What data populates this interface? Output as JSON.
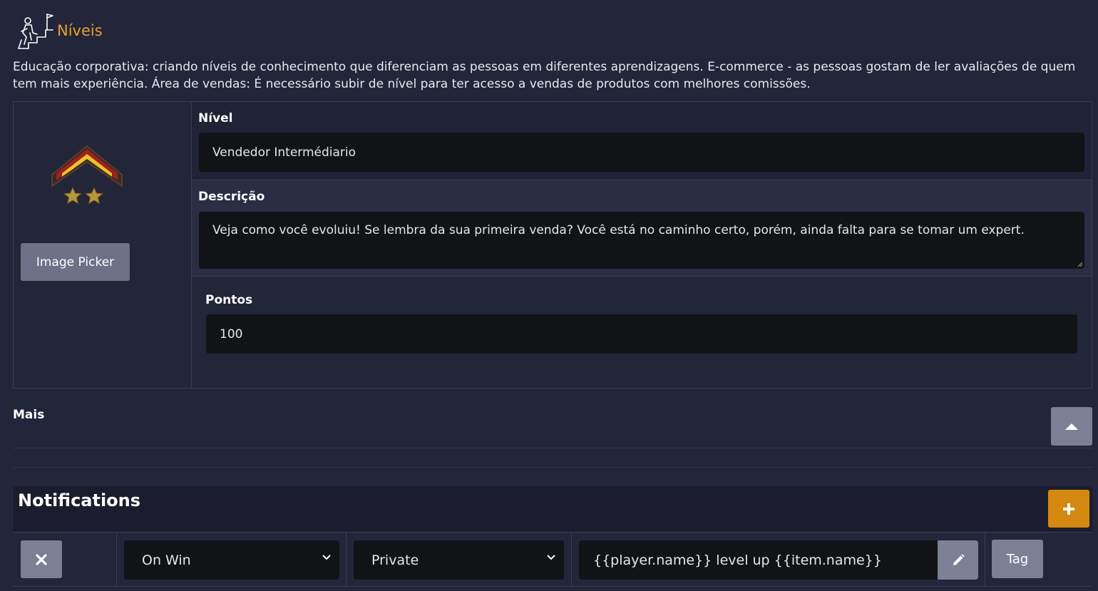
{
  "header": {
    "title": "Níveis",
    "icon": "leveling-person-stairs-icon",
    "accent_color": "#e6a12a"
  },
  "description": "Educação corporativa: criando níveis de conhecimento que diferenciam as pessoas em diferentes aprendizagens. E-commerce - as pessoas gostam de ler avaliações de quem tem mais experiência. Área de vendas: É necessário subir de nível para ter acesso a vendas de produtos com melhores comissões.",
  "image_picker": {
    "badge_icon": "rank-chevron-two-stars-icon",
    "button_label": "Image Picker"
  },
  "form": {
    "nivel_label": "Nível",
    "nivel_value": "Vendedor Intermédiario",
    "descricao_label": "Descrição",
    "descricao_value": "Veja como você evoluiu! Se lembra da sua primeira venda? Você está no caminho certo, porém, ainda falta para se tomar um expert.",
    "pontos_label": "Pontos",
    "pontos_value": "100"
  },
  "mais": {
    "label": "Mais",
    "toggle_icon": "caret-up-icon"
  },
  "notifications": {
    "title": "Notifications",
    "add_icon": "plus-icon",
    "add_color": "#d68910",
    "rows": [
      {
        "remove_icon": "close-icon",
        "trigger": "On Win",
        "visibility": "Private",
        "template": "{{player.name}} level up {{item.name}}",
        "edit_icon": "pencil-icon",
        "tag_label": "Tag"
      }
    ]
  }
}
